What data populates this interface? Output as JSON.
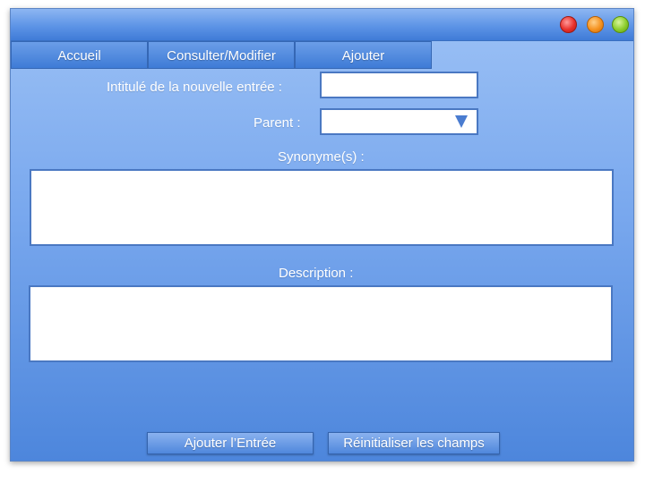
{
  "window": {
    "controls": {
      "close": "close-icon",
      "minimize": "minimize-icon",
      "zoom": "zoom-icon"
    },
    "colors": {
      "close": "#e8302a",
      "minimize": "#f5921f",
      "zoom": "#8ccd2c",
      "accent": "#4a86dc"
    }
  },
  "tabs": [
    {
      "label": "Accueil"
    },
    {
      "label": "Consulter/Modifier"
    },
    {
      "label": "Ajouter"
    }
  ],
  "form": {
    "title_label": "Intitulé de la nouvelle entrée :",
    "title_value": "",
    "parent_label": "Parent :",
    "parent_value": "",
    "parent_icon": "dropdown-arrow-icon",
    "synonyms_label": "Synonyme(s) :",
    "synonyms_value": "",
    "description_label": "Description :",
    "description_value": ""
  },
  "actions": {
    "add_label": "Ajouter l’Entrée",
    "reset_label": "Réinitialiser les champs"
  }
}
